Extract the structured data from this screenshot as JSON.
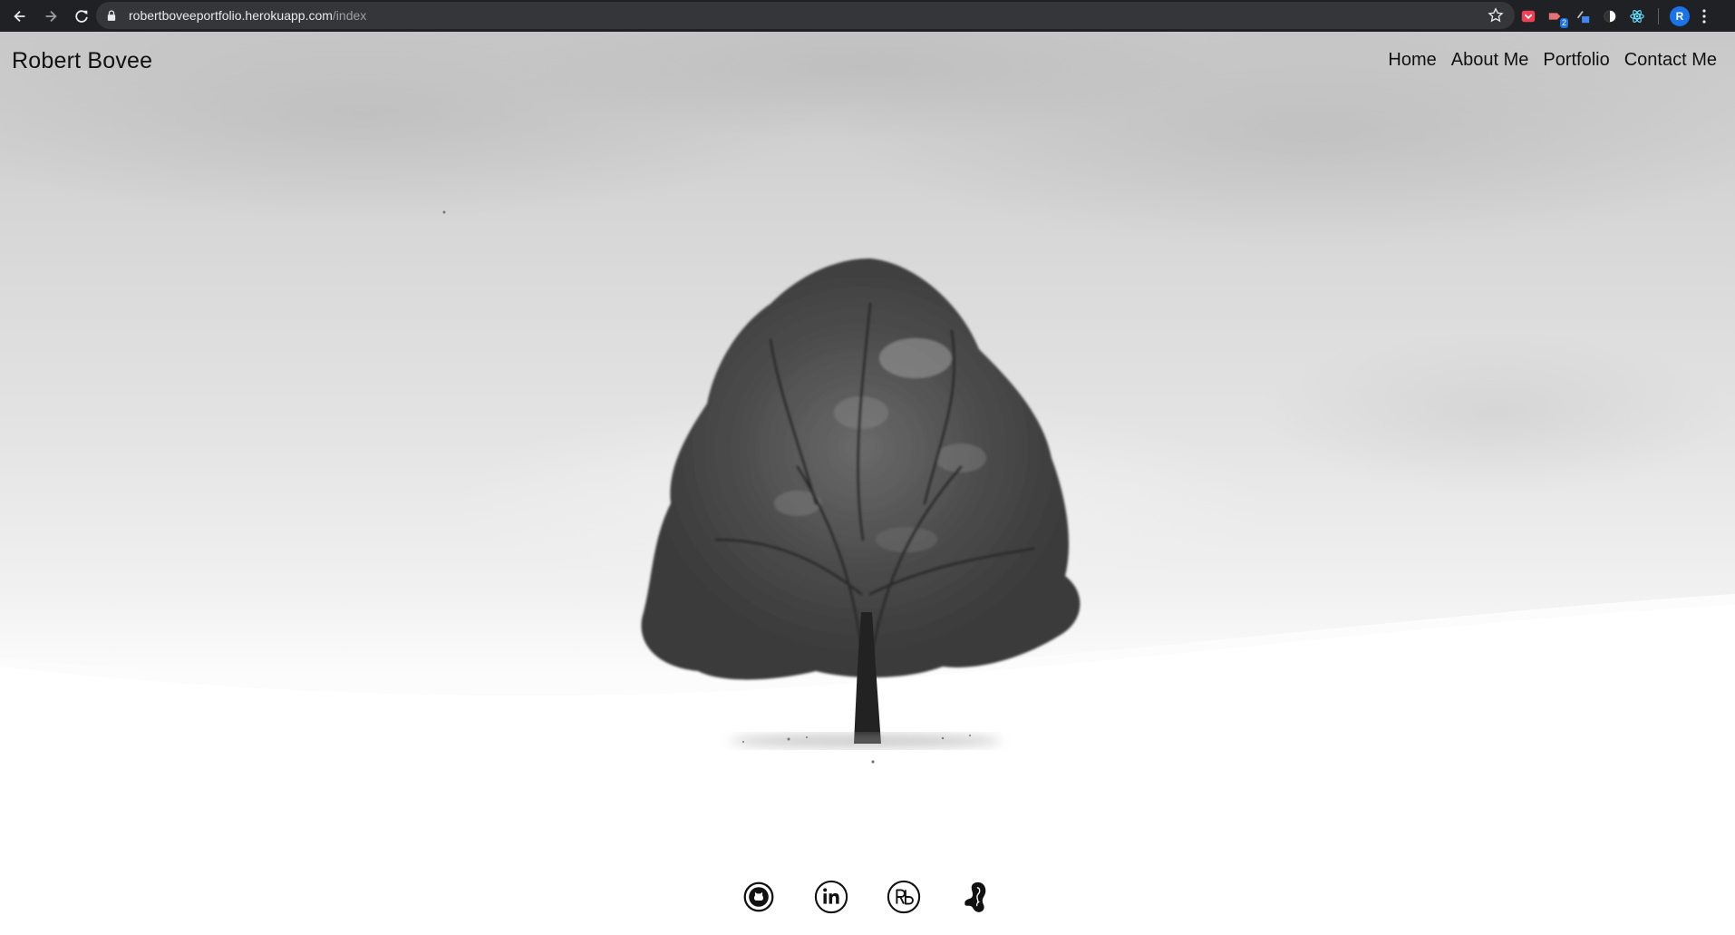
{
  "browser": {
    "url_host": "robertboveeportfolio.herokuapp.com",
    "url_path": "/index",
    "profile_initial": "R",
    "extension_badge": "2"
  },
  "site": {
    "brand": "Robert Bovee",
    "nav": [
      "Home",
      "About Me",
      "Portfolio",
      "Contact Me"
    ]
  },
  "hero": {
    "image_subject": "lone tree on snowy hill, black and white"
  },
  "socials": [
    "github-icon",
    "linkedin-icon",
    "rb-logo-icon",
    "kidney-icon"
  ]
}
